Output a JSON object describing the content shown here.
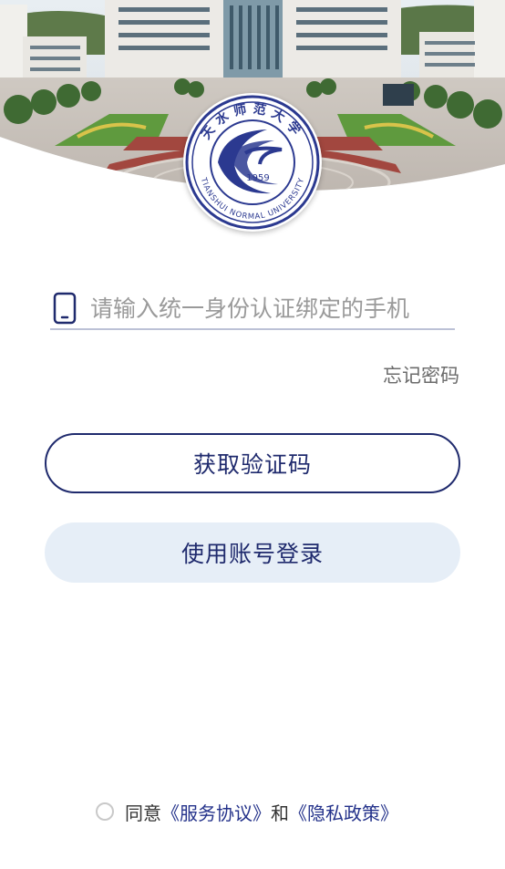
{
  "header": {
    "logo": {
      "icon": "university-seal-icon",
      "seal_top_text": "天水师范大学",
      "seal_bottom_text": "TIANSHUI NORMAL UNIVERSITY",
      "seal_year": "1959",
      "color": "#2b3990"
    }
  },
  "login": {
    "phone_icon": "mobile-phone-icon",
    "phone_placeholder": "请输入统一身份认证绑定的手机",
    "forgot_password": "忘记密码",
    "get_code_button": "获取验证码",
    "account_login_button": "使用账号登录"
  },
  "agreement": {
    "prefix": "同意",
    "service_link": "《服务协议》",
    "joiner": "和",
    "privacy_link": "《隐私政策》",
    "checked": false
  },
  "colors": {
    "primary": "#1f2a6d",
    "button_light_bg": "#e6eef7",
    "link": "#23318a"
  }
}
